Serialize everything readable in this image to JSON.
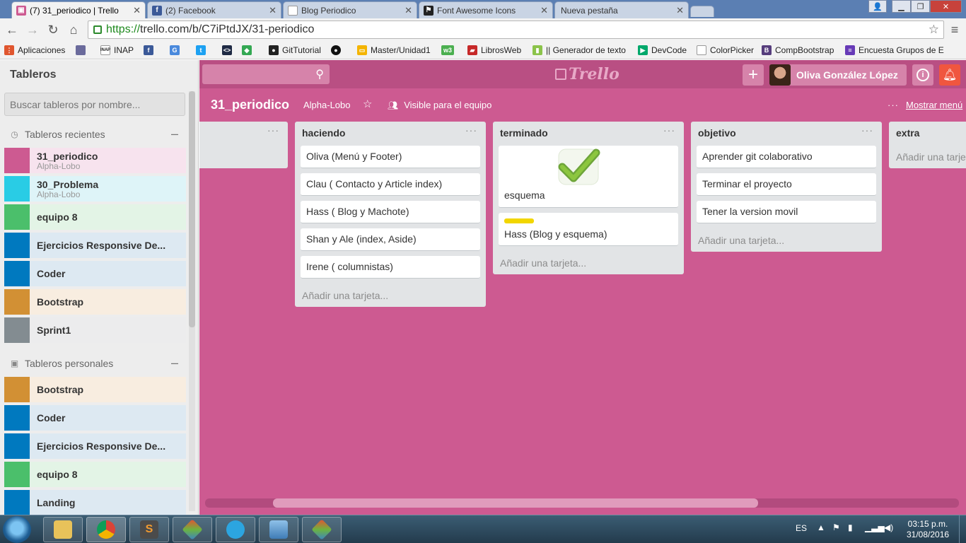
{
  "browser": {
    "tabs": [
      {
        "title": "(7) 31_periodico | Trello",
        "active": true,
        "icon": "trello-icon"
      },
      {
        "title": "(2) Facebook",
        "active": false,
        "icon": "facebook-icon"
      },
      {
        "title": "Blog Periodico",
        "active": false,
        "icon": "page-icon"
      },
      {
        "title": "Font Awesome Icons",
        "active": false,
        "icon": "flag-icon"
      },
      {
        "title": "Nueva pestaña",
        "active": false,
        "icon": ""
      }
    ],
    "url_scheme": "https://",
    "url_rest": "trello.com/b/C7iPtdJX/31-periodico"
  },
  "bookmarks": [
    "Aplicaciones",
    "",
    "INAP",
    "",
    "",
    "",
    "",
    "",
    "GitTutorial",
    "",
    "Master/Unidad1",
    "",
    "LibrosWeb",
    "|| Generador de texto",
    "DevCode",
    "ColorPicker",
    "CompBootstrap",
    "Encuesta Grupos de E"
  ],
  "sidebar": {
    "title": "Tableros",
    "search_placeholder": "Buscar tableros por nombre...",
    "recent_heading": "Tableros recientes",
    "recent": [
      {
        "name": "31_periodico",
        "sub": "Alpha-Lobo",
        "color": "#cd5a91",
        "bg": "#f7e3ee"
      },
      {
        "name": "30_Problema",
        "sub": "Alpha-Lobo",
        "color": "#29cce5",
        "bg": "#def4f8"
      },
      {
        "name": "equipo 8",
        "sub": "",
        "color": "#4bbf6b",
        "bg": "#e3f4e6"
      },
      {
        "name": "Ejercicios Responsive De...",
        "sub": "",
        "color": "#0079bf",
        "bg": "#dde9f2"
      },
      {
        "name": "Coder",
        "sub": "",
        "color": "#0079bf",
        "bg": "#dde9f2"
      },
      {
        "name": "Bootstrap",
        "sub": "",
        "color": "#d29034",
        "bg": "#f8ede0"
      },
      {
        "name": "Sprint1",
        "sub": "",
        "color": "#838c91",
        "bg": "#ececed"
      }
    ],
    "personal_heading": "Tableros personales",
    "personal": [
      {
        "name": "Bootstrap",
        "color": "#d29034",
        "bg": "#f8ede0"
      },
      {
        "name": "Coder",
        "color": "#0079bf",
        "bg": "#dde9f2"
      },
      {
        "name": "Ejercicios Responsive De...",
        "color": "#0079bf",
        "bg": "#dde9f2"
      },
      {
        "name": "equipo 8",
        "color": "#4bbf6b",
        "bg": "#e3f4e6"
      },
      {
        "name": "Landing",
        "color": "#0079bf",
        "bg": "#dde9f2"
      }
    ]
  },
  "header": {
    "logo": "Trello",
    "user_name": "Oliva González López",
    "add_label": "+"
  },
  "board": {
    "name": "31_periodico",
    "team": "Alpha-Lobo",
    "visibility": "Visible para el equipo",
    "menu_label": "Mostrar menú",
    "lists": [
      {
        "title": "",
        "cards": []
      },
      {
        "title": "haciendo",
        "cards": [
          "Oliva (Menú y Footer)",
          "Clau ( Contacto y Article index)",
          "Hass ( Blog y Machote)",
          "Shan y Ale (index, Aside)",
          "Irene ( columnistas)"
        ],
        "add": "Añadir una tarjeta..."
      },
      {
        "title": "terminado",
        "cards": [
          "esquema",
          "Hass (Blog y esquema)"
        ],
        "add": "Añadir una tarjeta..."
      },
      {
        "title": "objetivo",
        "cards": [
          "Aprender git colaborativo",
          "Terminar el proyecto",
          "Tener la version movil"
        ],
        "add": "Añadir una tarjeta..."
      },
      {
        "title": "extra",
        "cards": [],
        "add": "Añadir una tarje"
      }
    ]
  },
  "taskbar": {
    "lang": "ES",
    "time": "03:15 p.m.",
    "date": "31/08/2016"
  },
  "colors": {
    "board_bg": "#cd5a91",
    "header_bg": "#b94f83",
    "notify": "#f0563f",
    "label_yellow": "#f2d600"
  }
}
